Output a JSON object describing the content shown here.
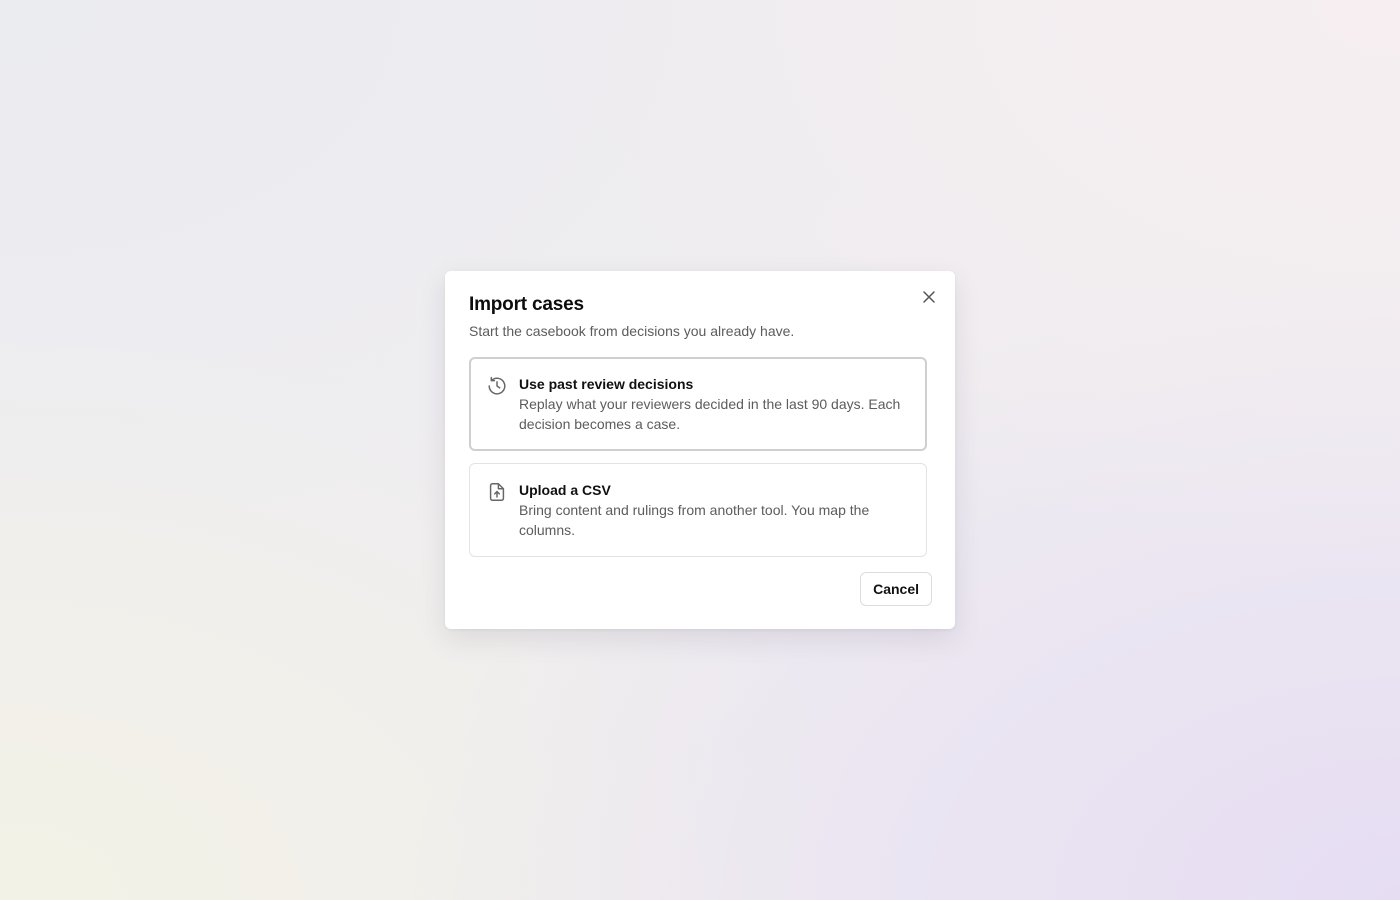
{
  "dialog": {
    "title": "Import cases",
    "subtitle": "Start the casebook from decisions you already have.",
    "close_icon": "close-icon",
    "options": [
      {
        "icon": "history-icon",
        "title": "Use past review decisions",
        "description": "Replay what your reviewers decided in the last 90 days. Each decision becomes a case.",
        "selected": true
      },
      {
        "icon": "file-upload-icon",
        "title": "Upload a CSV",
        "description": "Bring content and rulings from another tool. You map the columns.",
        "selected": false
      }
    ],
    "cancel_label": "Cancel"
  }
}
